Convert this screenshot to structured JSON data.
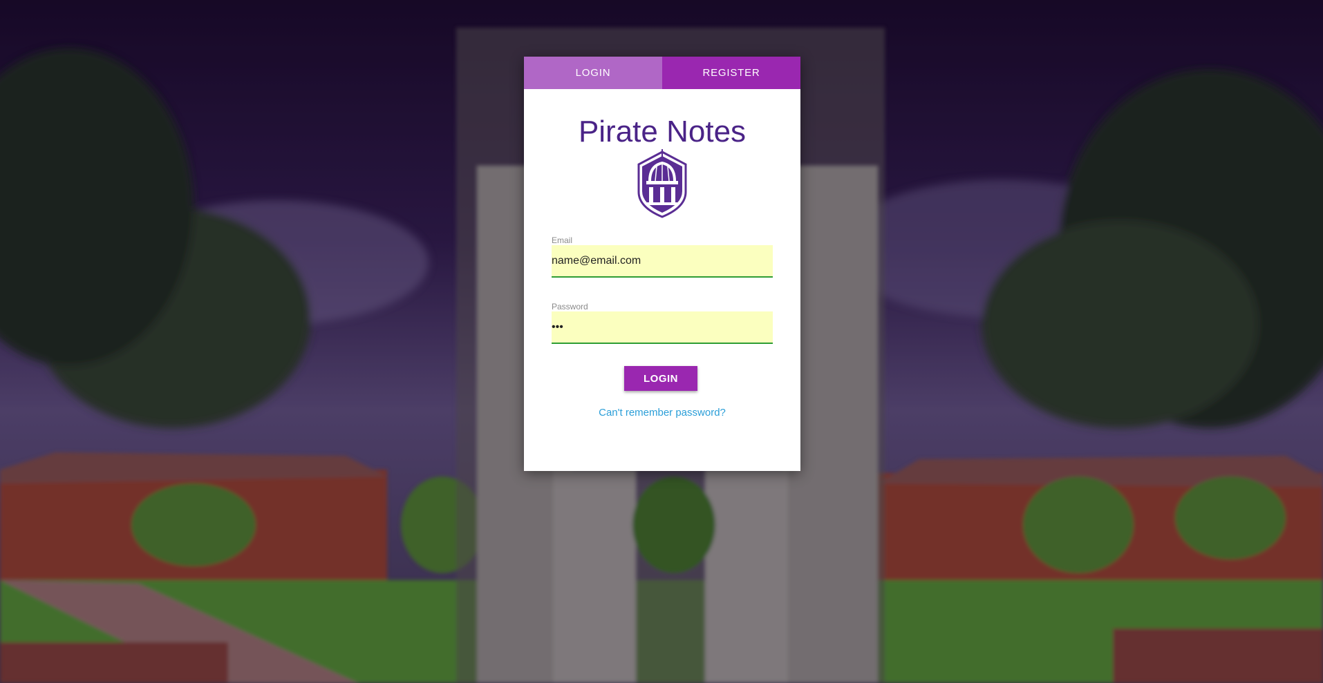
{
  "tabs": {
    "login": "LOGIN",
    "register": "REGISTER"
  },
  "app": {
    "title": "Pirate Notes",
    "logo_icon": "cupola-shield-icon"
  },
  "form": {
    "email_label": "Email",
    "email_value": "name@email.com",
    "password_label": "Password",
    "password_value": "•••",
    "login_button": "LOGIN",
    "forgot_link": "Can't remember password?"
  },
  "colors": {
    "tab_login": "#b067c6",
    "tab_register": "#9a27b0",
    "title": "#4a2387",
    "button": "#9a27b0",
    "link": "#2a9ed8",
    "input_fill": "#fbffbf",
    "input_underline": "#2d9c33"
  }
}
